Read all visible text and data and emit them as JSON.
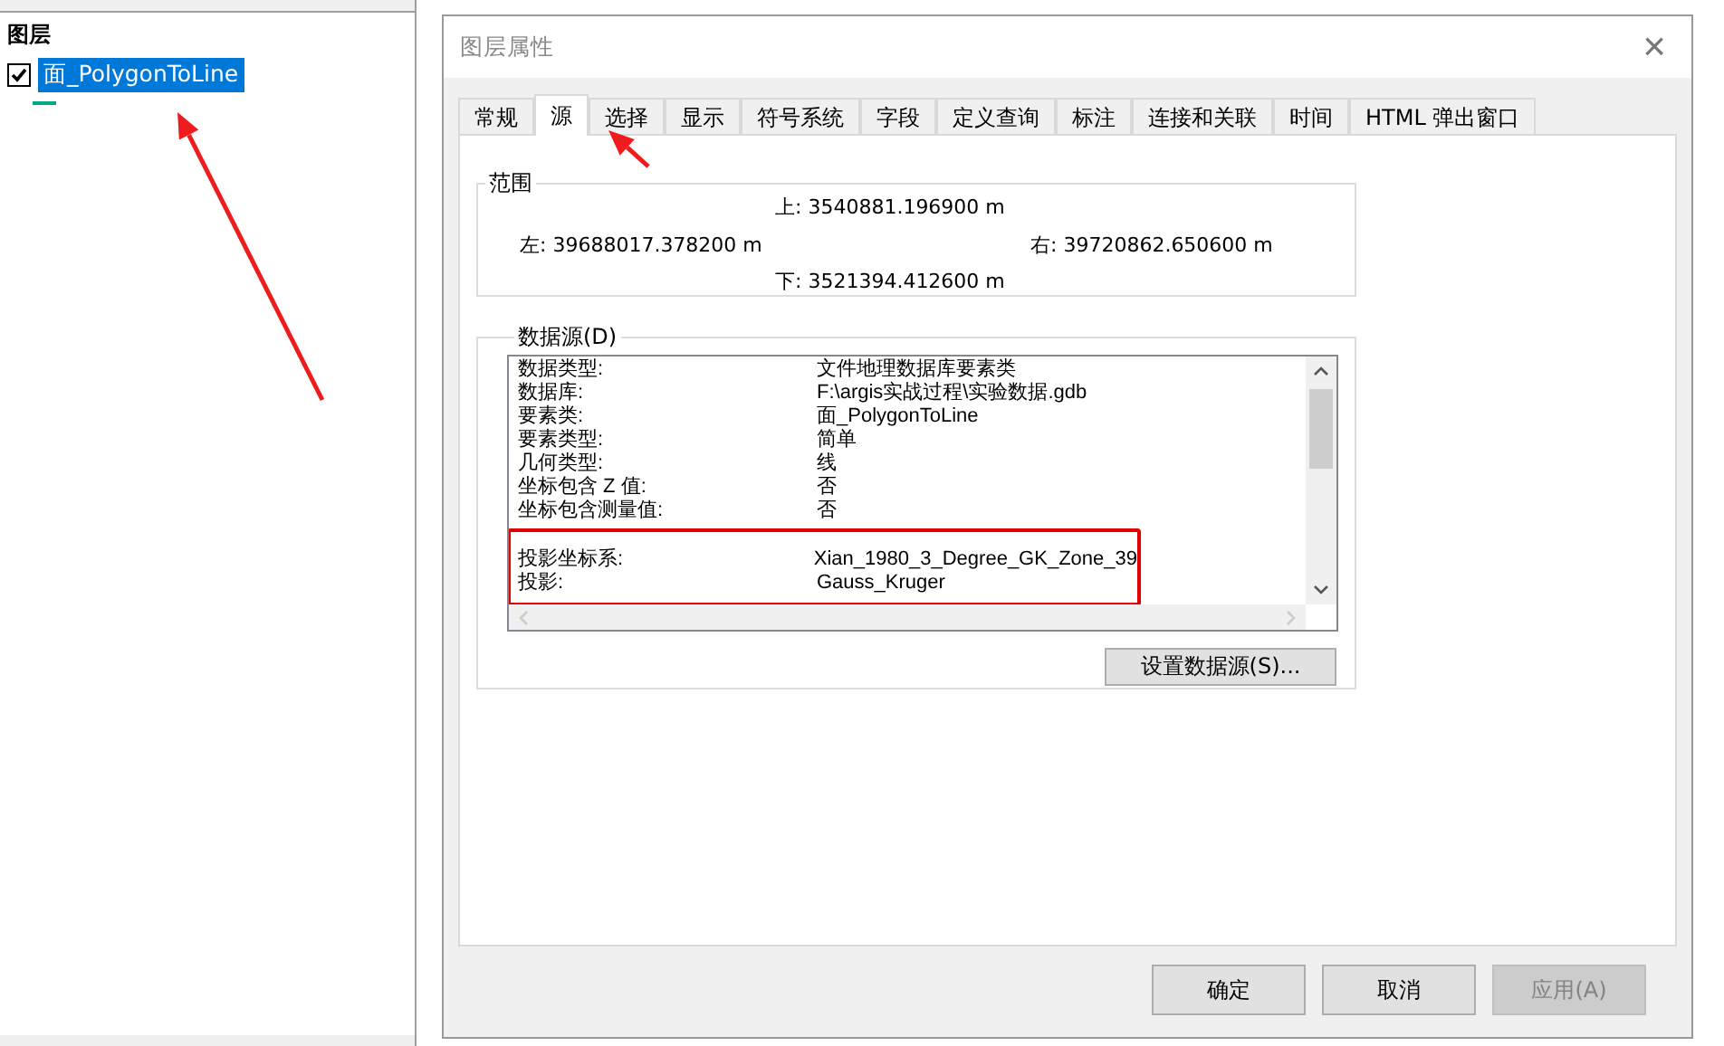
{
  "layers_panel": {
    "title": "图层",
    "layers": [
      {
        "name": "面_PolygonToLine",
        "checked": true,
        "selected": true
      }
    ]
  },
  "dialog": {
    "title": "图层属性",
    "close": "×",
    "tabs": [
      {
        "label": "常规",
        "selected": false
      },
      {
        "label": "源",
        "selected": true
      },
      {
        "label": "选择",
        "selected": false
      },
      {
        "label": "显示",
        "selected": false
      },
      {
        "label": "符号系统",
        "selected": false
      },
      {
        "label": "字段",
        "selected": false
      },
      {
        "label": "定义查询",
        "selected": false
      },
      {
        "label": "标注",
        "selected": false
      },
      {
        "label": "连接和关联",
        "selected": false
      },
      {
        "label": "时间",
        "selected": false
      },
      {
        "label": "HTML 弹出窗口",
        "selected": false
      }
    ],
    "extent": {
      "title": "范围",
      "top_label": "上:",
      "top": "3540881.196900 m",
      "left_label": "左:",
      "left": "39688017.378200 m",
      "right_label": "右:",
      "right": "39720862.650600 m",
      "bottom_label": "下:",
      "bottom": "3521394.412600 m"
    },
    "data_source": {
      "title": "数据源(D)",
      "groups": [
        {
          "rows": [
            {
              "label": "数据类型:",
              "value": "文件地理数据库要素类"
            },
            {
              "label": "数据库:",
              "value": "F:\\argis实战过程\\实验数据.gdb"
            },
            {
              "label": "要素类:",
              "value": "面_PolygonToLine"
            },
            {
              "label": "要素类型:",
              "value": "简单"
            },
            {
              "label": "几何类型:",
              "value": "线"
            },
            {
              "label": "坐标包含 Z 值:",
              "value": "否"
            },
            {
              "label": "坐标包含测量值:",
              "value": "否"
            }
          ]
        },
        {
          "rows": [
            {
              "label": "投影坐标系:",
              "value": "Xian_1980_3_Degree_GK_Zone_39"
            },
            {
              "label": "投影:",
              "value": "Gauss_Kruger"
            }
          ]
        }
      ],
      "set_button": "设置数据源(S)..."
    },
    "buttons": [
      {
        "label": "确定",
        "disabled": false
      },
      {
        "label": "取消",
        "disabled": false
      },
      {
        "label": "应用(A)",
        "disabled": true
      }
    ]
  },
  "annotations": [
    {
      "kind": "arrow"
    },
    {
      "kind": "arrow"
    },
    {
      "kind": "box"
    }
  ]
}
